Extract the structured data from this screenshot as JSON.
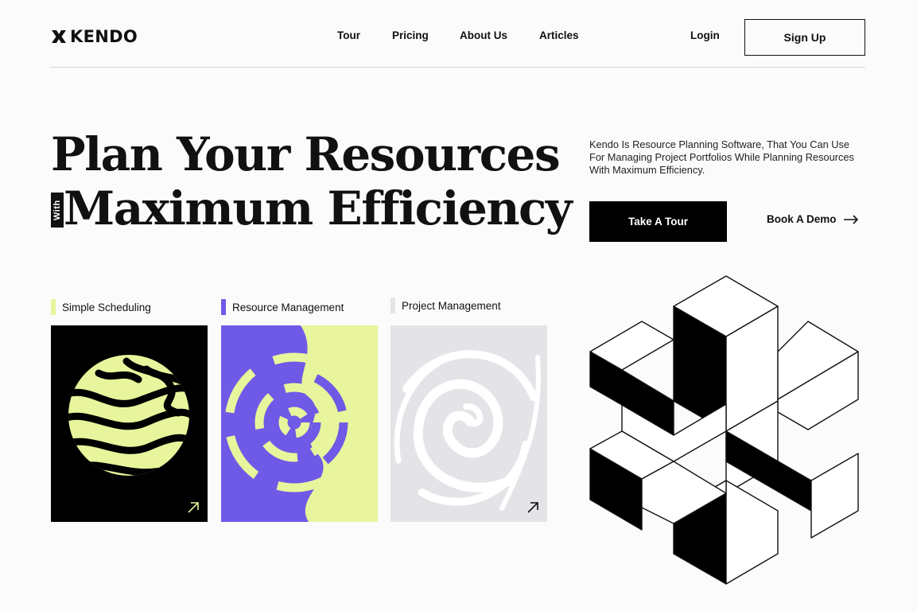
{
  "brand": {
    "name": "KENDO",
    "logo_icon": "kendo-x-mark-icon"
  },
  "nav": {
    "items": [
      {
        "label": "Tour"
      },
      {
        "label": "Pricing"
      },
      {
        "label": "About Us"
      },
      {
        "label": "Articles"
      }
    ],
    "login_label": "Login",
    "signup_label": "Sign Up"
  },
  "hero": {
    "title_line1": "Plan Your Resources",
    "title_tag": "With",
    "title_line2": "Maximum Efficiency",
    "description": "Kendo Is Resource Planning Software, That You Can Use For Managing Project Portfolios While Planning Resources With Maximum Efficiency.",
    "primary_cta": "Take A Tour",
    "secondary_cta": "Book A Demo",
    "secondary_cta_icon": "arrow-right-icon"
  },
  "features": [
    {
      "label": "Simple Scheduling",
      "accent": "#e8f59c",
      "card_bg": "#000000",
      "art_color": "#e8f59c",
      "icon": "arrow-up-right-icon"
    },
    {
      "label": "Resource Management",
      "accent": "#6e5ae6",
      "card_bg": "#6e5ae6",
      "art_color": "#e8f59c",
      "icon": "arrow-up-right-icon"
    },
    {
      "label": "Project Management",
      "accent": "#e4e4e8",
      "card_bg": "#e4e4e8",
      "art_color": "#ffffff",
      "icon": "arrow-up-right-icon"
    }
  ],
  "colors": {
    "ink": "#111111",
    "lime": "#e8f59c",
    "violet": "#6e5ae6",
    "light_gray": "#e4e4e8"
  }
}
